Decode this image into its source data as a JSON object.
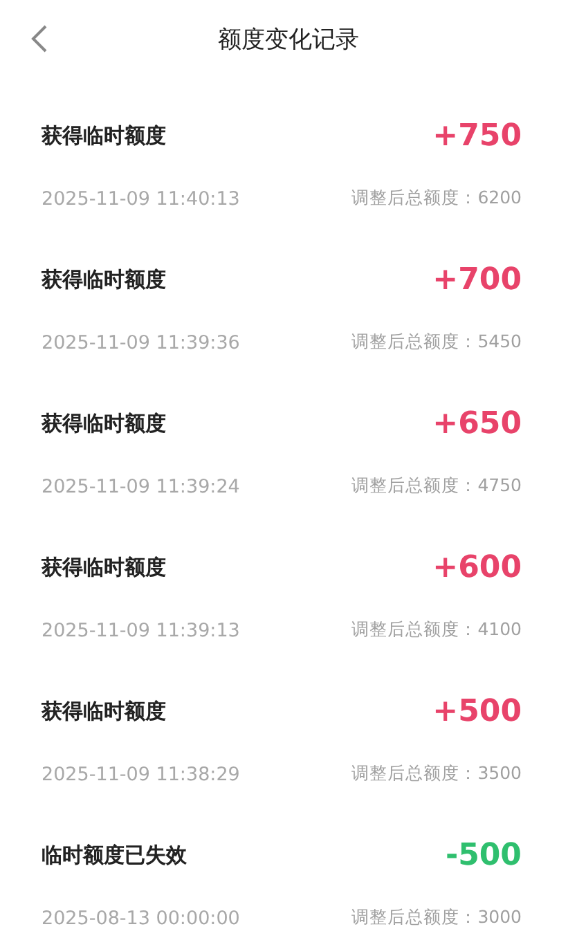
{
  "header": {
    "title": "额度变化记录"
  },
  "records": [
    {
      "title": "获得临时额度",
      "time": "2025-11-09 11:40:13",
      "amount": "+750",
      "kind": "increase",
      "total": "调整后总额度：6200"
    },
    {
      "title": "获得临时额度",
      "time": "2025-11-09 11:39:36",
      "amount": "+700",
      "kind": "increase",
      "total": "调整后总额度：5450"
    },
    {
      "title": "获得临时额度",
      "time": "2025-11-09 11:39:24",
      "amount": "+650",
      "kind": "increase",
      "total": "调整后总额度：4750"
    },
    {
      "title": "获得临时额度",
      "time": "2025-11-09 11:39:13",
      "amount": "+600",
      "kind": "increase",
      "total": "调整后总额度：4100"
    },
    {
      "title": "获得临时额度",
      "time": "2025-11-09 11:38:29",
      "amount": "+500",
      "kind": "increase",
      "total": "调整后总额度：3500"
    },
    {
      "title": "临时额度已失效",
      "time": "2025-08-13 00:00:00",
      "amount": "-500",
      "kind": "decrease",
      "total": "调整后总额度：3000"
    }
  ]
}
